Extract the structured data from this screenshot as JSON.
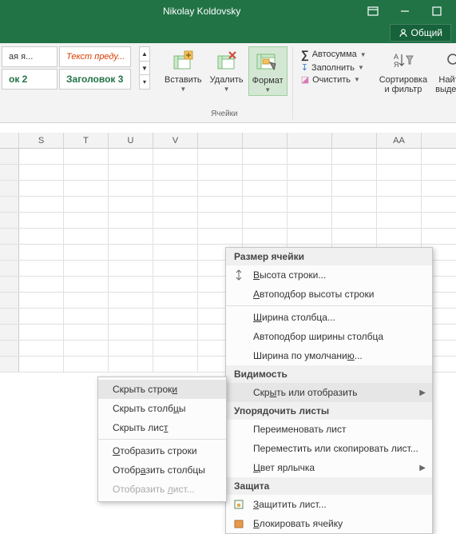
{
  "title_bar": {
    "user": "Nikolay Koldovsky"
  },
  "share_btn": "Общий",
  "styles": {
    "r1c1": "ая я...",
    "r1c2": "Текст преду...",
    "r2c1": "ок 2",
    "r2c2": "Заголовок 3"
  },
  "ribbon": {
    "insert": "Вставить",
    "delete": "Удалить",
    "format": "Формат",
    "cells_group": "Ячейки",
    "autosum": "Автосумма",
    "fill": "Заполнить",
    "clear": "Очистить",
    "sort_filter_l1": "Сортировка",
    "sort_filter_l2": "и фильтр",
    "find_l1": "Найти и",
    "find_l2": "выделить"
  },
  "columns": [
    "",
    "S",
    "T",
    "U",
    "V",
    "",
    "",
    "",
    "",
    "AA"
  ],
  "format_menu": {
    "h_size": "Размер ячейки",
    "row_height": "Высота строки...",
    "autofit_row": "Автоподбор высоты строки",
    "col_width": "Ширина столбца...",
    "autofit_col": "Автоподбор ширины столбца",
    "default_width": "Ширина по умолчанию...",
    "h_vis": "Видимость",
    "hide_show": "Скрыть или отобразить",
    "h_org": "Упорядочить листы",
    "rename": "Переименовать лист",
    "move": "Переместить или скопировать лист...",
    "tab_color": "Цвет ярлычка",
    "h_prot": "Защита",
    "protect": "Защитить лист...",
    "lock": "Блокировать ячейку"
  },
  "hide_menu": {
    "hide_rows": "Скрыть строки",
    "hide_cols": "Скрыть столбцы",
    "hide_sheet": "Скрыть лист",
    "show_rows": "Отобразить строки",
    "show_cols": "Отобразить столбцы",
    "show_sheet": "Отобразить лист..."
  }
}
